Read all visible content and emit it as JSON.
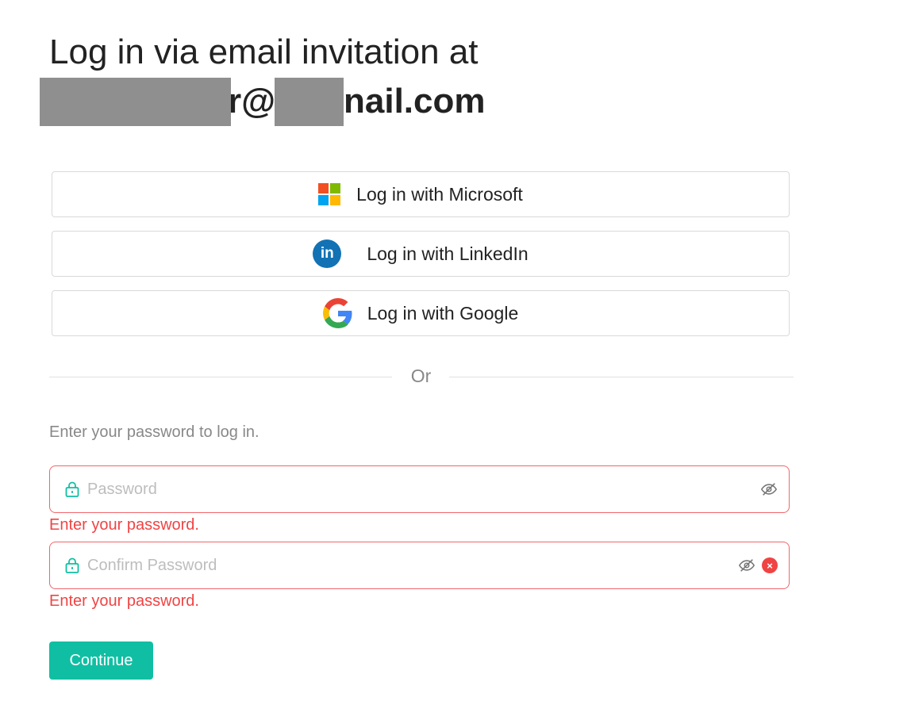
{
  "title": {
    "line1": "Log in via email invitation at",
    "email_visible": "r@y    nail.com"
  },
  "sso": {
    "microsoft_label": "Log in with Microsoft",
    "linkedin_label": "Log in with LinkedIn",
    "google_label": "Log in with Google",
    "linkedin_icon_text": "in"
  },
  "divider": {
    "label": "Or"
  },
  "form": {
    "hint": "Enter your password to log in.",
    "password_placeholder": "Password",
    "confirm_placeholder": "Confirm Password",
    "password_error": "Enter your password.",
    "confirm_error": "Enter your password.",
    "continue_label": "Continue",
    "clear_icon_text": "×"
  },
  "colors": {
    "accent": "#10bfa3",
    "error": "#ef4444",
    "linkedin": "#1272b4",
    "ms_red": "#f25022",
    "ms_green": "#7fba00",
    "ms_blue": "#00a4ef",
    "ms_yellow": "#ffb900"
  },
  "icons": {
    "microsoft": "microsoft-logo-icon",
    "linkedin": "linkedin-logo-icon",
    "google": "google-logo-icon",
    "lock": "lock-icon",
    "eye_off": "eye-off-icon",
    "clear": "clear-icon"
  }
}
